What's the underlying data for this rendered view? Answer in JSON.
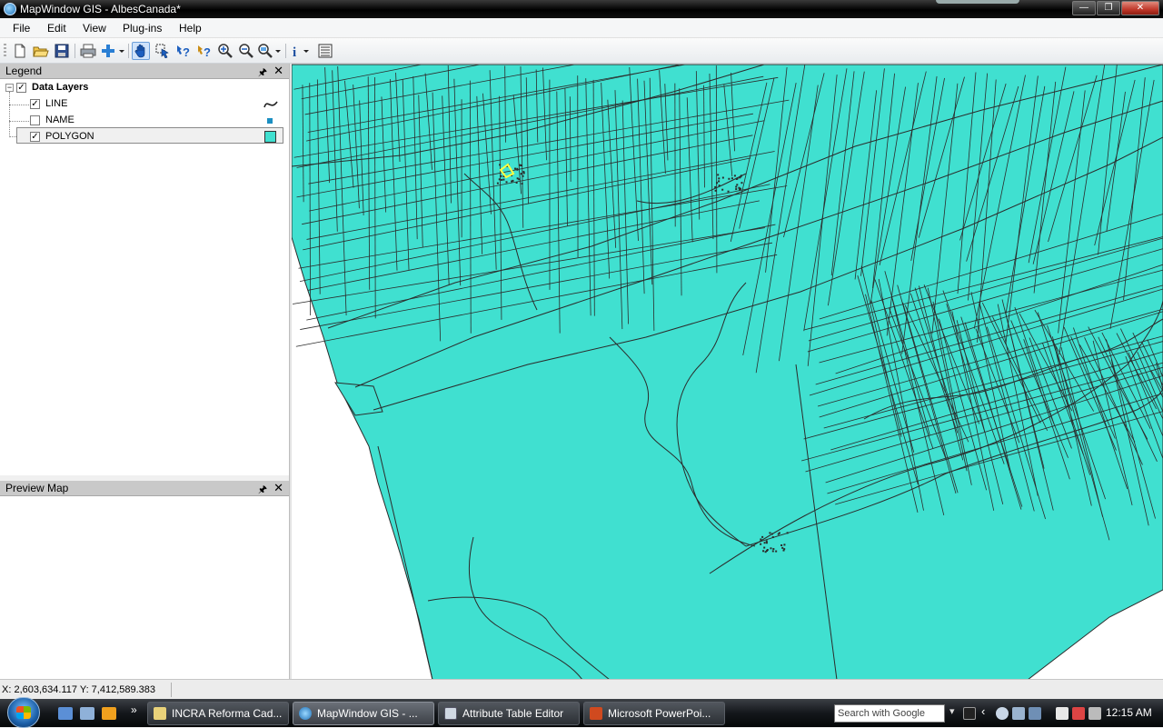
{
  "window": {
    "title": "MapWindow GIS  - AlbesCanada*",
    "controls": [
      "minimize-icon",
      "maximize-icon",
      "close-icon"
    ]
  },
  "menu": [
    "File",
    "Edit",
    "View",
    "Plug-ins",
    "Help"
  ],
  "toolbar": {
    "icons": [
      "new-icon",
      "open-icon",
      "save-icon",
      "print-icon",
      "add-layer-icon",
      "pan-icon",
      "select-icon",
      "identify-icon",
      "query-icon",
      "zoom-in-icon",
      "zoom-out-icon",
      "zoom-extent-icon",
      "info-icon",
      "attribute-table-icon"
    ],
    "active": "pan-icon"
  },
  "legend": {
    "header": "Legend",
    "group": "Data Layers",
    "layers": [
      {
        "name": "LINE",
        "checked": true,
        "symbol": "line-symbol-icon"
      },
      {
        "name": "NAME",
        "checked": false,
        "symbol": "point-symbol-icon"
      },
      {
        "name": "POLYGON",
        "checked": true,
        "symbol": "polygon-symbol-icon"
      }
    ],
    "selected": "POLYGON"
  },
  "preview": {
    "header": "Preview Map"
  },
  "map": {
    "fill_color": "#40E0D0",
    "line_color": "#2b2b2b",
    "highlight_color": "#ffff40"
  },
  "status": {
    "coords": "X: 2,603,634.117 Y: 7,412,589.383"
  },
  "taskbar": {
    "buttons": [
      {
        "label": "INCRA Reforma Cad...",
        "active": false
      },
      {
        "label": "MapWindow GIS  - ...",
        "active": true
      },
      {
        "label": "Attribute Table Editor",
        "active": false
      },
      {
        "label": "Microsoft PowerPoi...",
        "active": false
      }
    ],
    "search_placeholder": "Search with Google",
    "clock": "12:15 AM",
    "overflow": "»"
  }
}
